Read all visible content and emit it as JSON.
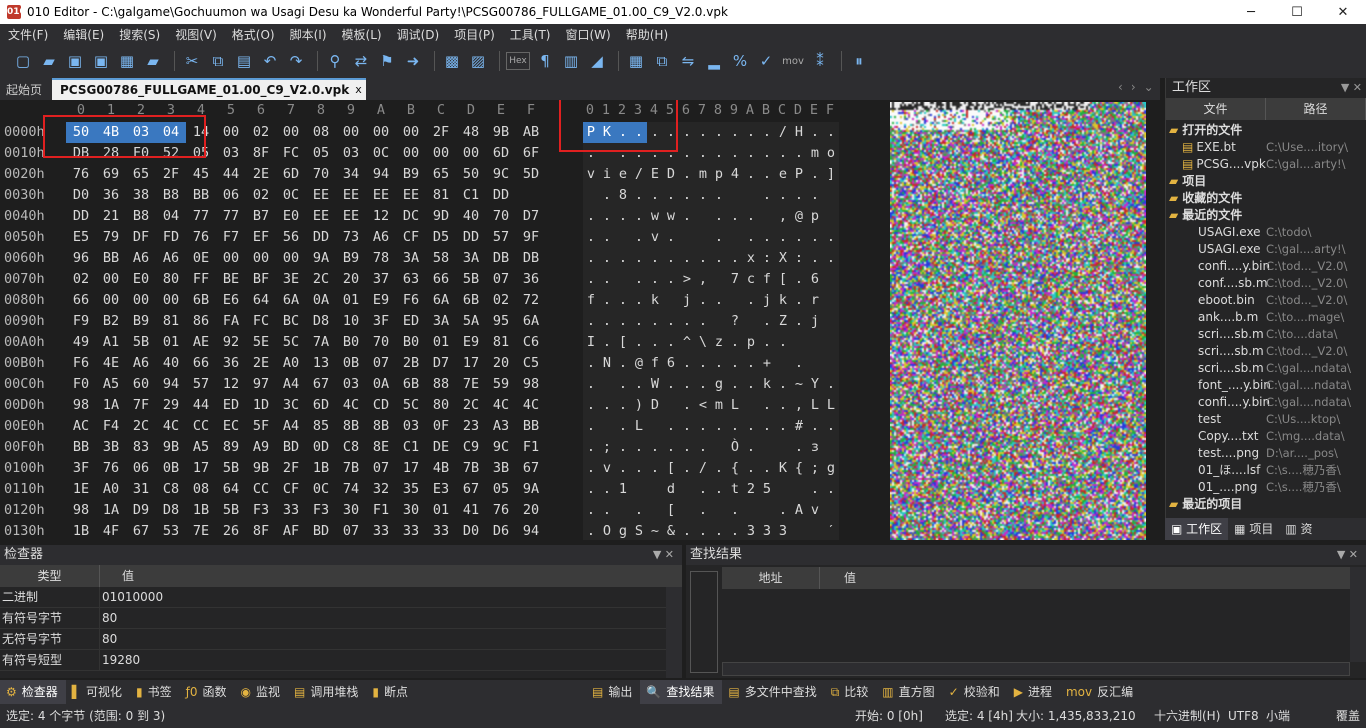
{
  "titlebar": {
    "app_glyph": "010",
    "title": "010 Editor - C:\\galgame\\Gochuumon wa Usagi Desu ka Wonderful Party!\\PCSG00786_FULLGAME_01.00_C9_V2.0.vpk",
    "minimize": "─",
    "maximize": "☐",
    "close": "✕"
  },
  "menu": [
    "文件(F)",
    "编辑(E)",
    "搜索(S)",
    "视图(V)",
    "格式(O)",
    "脚本(I)",
    "模板(L)",
    "调试(D)",
    "项目(P)",
    "工具(T)",
    "窗口(W)",
    "帮助(H)"
  ],
  "toolbar": {
    "hex_label": "Hex",
    "mov_label": "mov"
  },
  "tabs": {
    "start": "起始页",
    "file": "PCSG00786_FULLGAME_01.00_C9_V2.0.vpk",
    "close": "x",
    "nav_prev": "‹",
    "nav_next": "›",
    "nav_menu": "⌄"
  },
  "hex": {
    "ruler": [
      "0",
      "1",
      "2",
      "3",
      "4",
      "5",
      "6",
      "7",
      "8",
      "9",
      "A",
      "B",
      "C",
      "D",
      "E",
      "F"
    ],
    "ascii_ruler": [
      "0",
      "1",
      "2",
      "3",
      "4",
      "5",
      "6",
      "7",
      "8",
      "9",
      "A",
      "B",
      "C",
      "D",
      "E",
      "F"
    ],
    "rows": [
      {
        "addr": "0000h",
        "bytes": [
          "50",
          "4B",
          "03",
          "04",
          "14",
          "00",
          "02",
          "00",
          "08",
          "00",
          "00",
          "00",
          "2F",
          "48",
          "9B",
          "AB"
        ],
        "ascii": [
          "P",
          "K",
          ".",
          ".",
          ".",
          ".",
          ".",
          ".",
          ".",
          ".",
          ".",
          ".",
          "/",
          "H",
          ".",
          "."
        ]
      },
      {
        "addr": "0010h",
        "bytes": [
          "DB",
          "28",
          "F0",
          "52",
          "05",
          "03",
          "8F",
          "FC",
          "05",
          "03",
          "0C",
          "00",
          "00",
          "00",
          "6D",
          "6F"
        ],
        "ascii": [
          ".",
          "",
          ".",
          ".",
          ".",
          ".",
          ".",
          ".",
          ".",
          ".",
          ".",
          ".",
          ".",
          ".",
          "m",
          "o"
        ]
      },
      {
        "addr": "0020h",
        "bytes": [
          "76",
          "69",
          "65",
          "2F",
          "45",
          "44",
          "2E",
          "6D",
          "70",
          "34",
          "94",
          "B9",
          "65",
          "50",
          "9C",
          "5D"
        ],
        "ascii": [
          "v",
          "i",
          "e",
          "/",
          "E",
          "D",
          ".",
          "m",
          "p",
          "4",
          ".",
          ".",
          "e",
          "P",
          ".",
          "]"
        ]
      },
      {
        "addr": "0030h",
        "bytes": [
          "D0",
          "36",
          "38",
          "B8",
          "BB",
          "06",
          "02",
          "0C",
          "EE",
          "EE",
          "EE",
          "EE",
          "81",
          "C1",
          "DD",
          ""
        ],
        "ascii": [
          "",
          ".",
          "8",
          ".",
          ".",
          ".",
          ".",
          ".",
          ".",
          "",
          "",
          ".",
          ".",
          ".",
          ".",
          ""
        ]
      },
      {
        "addr": "0040h",
        "bytes": [
          "DD",
          "21",
          "B8",
          "04",
          "77",
          "77",
          "B7",
          "E0",
          "EE",
          "EE",
          "12",
          "DC",
          "9D",
          "40",
          "70",
          "D7"
        ],
        "ascii": [
          ".",
          ".",
          ".",
          ".",
          "w",
          "w",
          ".",
          "",
          ".",
          ".",
          ".",
          "",
          ",",
          "@",
          "p",
          ""
        ]
      },
      {
        "addr": "0050h",
        "bytes": [
          "E5",
          "79",
          "DF",
          "FD",
          "76",
          "F7",
          "EF",
          "56",
          "DD",
          "73",
          "A6",
          "CF",
          "D5",
          "DD",
          "57",
          "9F"
        ],
        "ascii": [
          ".",
          ".",
          "",
          ".",
          "v",
          ".",
          "",
          "",
          ".",
          "",
          ".",
          ".",
          ".",
          ".",
          ".",
          "."
        ]
      },
      {
        "addr": "0060h",
        "bytes": [
          "96",
          "BB",
          "A6",
          "A6",
          "0E",
          "00",
          "00",
          "00",
          "9A",
          "B9",
          "78",
          "3A",
          "58",
          "3A",
          "DB",
          "DB"
        ],
        "ascii": [
          ".",
          ".",
          ".",
          ".",
          ".",
          ".",
          ".",
          ".",
          ".",
          ".",
          "x",
          ":",
          "X",
          ":",
          ".",
          "."
        ]
      },
      {
        "addr": "0070h",
        "bytes": [
          "02",
          "00",
          "E0",
          "80",
          "FF",
          "BE",
          "BF",
          "3E",
          "2C",
          "20",
          "37",
          "63",
          "66",
          "5B",
          "07",
          "36"
        ],
        "ascii": [
          ".",
          ".",
          "",
          ".",
          ".",
          ".",
          ">",
          ",",
          "",
          "7",
          "c",
          "f",
          "[",
          ".",
          "6",
          ""
        ]
      },
      {
        "addr": "0080h",
        "bytes": [
          "66",
          "00",
          "00",
          "00",
          "6B",
          "E6",
          "64",
          "6A",
          "0A",
          "01",
          "E9",
          "F6",
          "6A",
          "6B",
          "02",
          "72"
        ],
        "ascii": [
          "f",
          ".",
          ".",
          ".",
          "k",
          "",
          "j",
          ".",
          ".",
          "",
          ".",
          "j",
          "k",
          ".",
          "r",
          ""
        ]
      },
      {
        "addr": "0090h",
        "bytes": [
          "F9",
          "B2",
          "B9",
          "81",
          "86",
          "FA",
          "FC",
          "BC",
          "D8",
          "10",
          "3F",
          "ED",
          "3A",
          "5A",
          "95",
          "6A"
        ],
        "ascii": [
          ".",
          ".",
          ".",
          ".",
          ".",
          ".",
          ".",
          ".",
          "",
          "?",
          "",
          ".",
          "Z",
          ".",
          "j",
          ""
        ]
      },
      {
        "addr": "00A0h",
        "bytes": [
          "49",
          "A1",
          "5B",
          "01",
          "AE",
          "92",
          "5E",
          "5C",
          "7A",
          "B0",
          "70",
          "B0",
          "01",
          "E9",
          "81",
          "C6"
        ],
        "ascii": [
          "I",
          ".",
          "[",
          ".",
          ".",
          ".",
          "^",
          "\\",
          "z",
          ".",
          "p",
          ".",
          ".",
          "",
          "",
          ""
        ]
      },
      {
        "addr": "00B0h",
        "bytes": [
          "F6",
          "4E",
          "A6",
          "40",
          "66",
          "36",
          "2E",
          "A0",
          "13",
          "0B",
          "07",
          "2B",
          "D7",
          "17",
          "20",
          "C5"
        ],
        "ascii": [
          ".",
          "N",
          ".",
          "@",
          "f",
          "6",
          ".",
          ".",
          ".",
          ".",
          ".",
          "+",
          "",
          ".",
          "",
          ""
        ]
      },
      {
        "addr": "00C0h",
        "bytes": [
          "F0",
          "A5",
          "60",
          "94",
          "57",
          "12",
          "97",
          "A4",
          "67",
          "03",
          "0A",
          "6B",
          "88",
          "7E",
          "59",
          "98"
        ],
        "ascii": [
          ".",
          "",
          ".",
          ".",
          "W",
          ".",
          ".",
          ".",
          "g",
          ".",
          ".",
          "k",
          ".",
          "~",
          "Y",
          "."
        ]
      },
      {
        "addr": "00D0h",
        "bytes": [
          "98",
          "1A",
          "7F",
          "29",
          "44",
          "ED",
          "1D",
          "3C",
          "6D",
          "4C",
          "CD",
          "5C",
          "80",
          "2C",
          "4C",
          "4C"
        ],
        "ascii": [
          ".",
          ".",
          ".",
          ")",
          "D",
          "",
          ".",
          "<",
          "m",
          "L",
          "",
          ".",
          ".",
          ",",
          "L",
          "L"
        ]
      },
      {
        "addr": "00E0h",
        "bytes": [
          "AC",
          "F4",
          "2C",
          "4C",
          "CC",
          "EC",
          "5F",
          "A4",
          "85",
          "8B",
          "8B",
          "03",
          "0F",
          "23",
          "A3",
          "BB"
        ],
        "ascii": [
          ".",
          "",
          ".",
          "L",
          "",
          ".",
          ".",
          ".",
          ".",
          ".",
          ".",
          ".",
          ".",
          "#",
          ".",
          "."
        ]
      },
      {
        "addr": "00F0h",
        "bytes": [
          "BB",
          "3B",
          "83",
          "9B",
          "A5",
          "89",
          "A9",
          "BD",
          "0D",
          "C8",
          "8E",
          "C1",
          "DE",
          "C9",
          "9C",
          "F1"
        ],
        "ascii": [
          ".",
          ";",
          ".",
          ".",
          ".",
          ".",
          ".",
          ".",
          "",
          "Ò",
          ".",
          "",
          "",
          ".",
          "з",
          ""
        ]
      },
      {
        "addr": "0100h",
        "bytes": [
          "3F",
          "76",
          "06",
          "0B",
          "17",
          "5B",
          "9B",
          "2F",
          "1B",
          "7B",
          "07",
          "17",
          "4B",
          "7B",
          "3B",
          "67"
        ],
        "ascii": [
          ".",
          "v",
          ".",
          ".",
          ".",
          "[",
          ".",
          "/",
          ".",
          "{",
          ".",
          ".",
          "K",
          "{",
          ";",
          "g"
        ]
      },
      {
        "addr": "0110h",
        "bytes": [
          "1E",
          "A0",
          "31",
          "C8",
          "08",
          "64",
          "CC",
          "CF",
          "0C",
          "74",
          "32",
          "35",
          "E3",
          "67",
          "05",
          "9A"
        ],
        "ascii": [
          ".",
          ".",
          "1",
          "",
          "",
          "d",
          "",
          ".",
          ".",
          "t",
          "2",
          "5",
          "",
          "",
          ".",
          "."
        ]
      },
      {
        "addr": "0120h",
        "bytes": [
          "98",
          "1A",
          "D9",
          "D8",
          "1B",
          "5B",
          "F3",
          "33",
          "F3",
          "30",
          "F1",
          "30",
          "01",
          "41",
          "76",
          "20"
        ],
        "ascii": [
          ".",
          ".",
          "",
          ".",
          "",
          "[",
          "",
          ".",
          "",
          ".",
          "",
          "",
          ".",
          "A",
          "v",
          ""
        ]
      },
      {
        "addr": "0130h",
        "bytes": [
          "1B",
          "4F",
          "67",
          "53",
          "7E",
          "26",
          "8F",
          "AF",
          "BD",
          "07",
          "33",
          "33",
          "33",
          "D0",
          "D6",
          "94"
        ],
        "ascii": [
          ".",
          "O",
          "g",
          "S",
          "~",
          "&",
          ".",
          ".",
          ".",
          ".",
          "3",
          "3",
          "3",
          "",
          "",
          "ˊ"
        ]
      }
    ]
  },
  "workspace": {
    "title": "工作区",
    "pin": "▼ ✕",
    "col_file": "文件",
    "col_path": "路径",
    "groups": [
      {
        "label": "打开的文件",
        "items": [
          {
            "name": "EXE.bt",
            "path": "C:\\Use....itory\\"
          },
          {
            "name": "PCSG....vpk",
            "path": "C:\\gal....arty!\\"
          }
        ]
      },
      {
        "label": "项目",
        "items": []
      },
      {
        "label": "收藏的文件",
        "items": []
      },
      {
        "label": "最近的文件",
        "items": [
          {
            "name": "USAGI.exe",
            "path": "C:\\todo\\"
          },
          {
            "name": "USAGI.exe",
            "path": "C:\\gal....arty!\\"
          },
          {
            "name": "confi....y.bin",
            "path": "C:\\tod..._V2.0\\"
          },
          {
            "name": "conf....sb.m",
            "path": "C:\\tod..._V2.0\\"
          },
          {
            "name": "eboot.bin",
            "path": "C:\\tod..._V2.0\\"
          },
          {
            "name": "ank....b.m",
            "path": "C:\\to....mage\\"
          },
          {
            "name": "scri....sb.m",
            "path": "C:\\to....data\\"
          },
          {
            "name": "scri....sb.m",
            "path": "C:\\tod..._V2.0\\"
          },
          {
            "name": "scri....sb.m",
            "path": "C:\\gal....ndata\\"
          },
          {
            "name": "font_....y.bin",
            "path": "C:\\gal....ndata\\"
          },
          {
            "name": "confi....y.bin",
            "path": "C:\\gal....ndata\\"
          },
          {
            "name": "test",
            "path": "C:\\Us....ktop\\"
          },
          {
            "name": "Copy....txt",
            "path": "C:\\mg....data\\"
          },
          {
            "name": "test....png",
            "path": "D:\\ar...._pos\\"
          },
          {
            "name": "01_ほ....lsf",
            "path": "C:\\s....穂乃香\\"
          },
          {
            "name": "01_....png",
            "path": "C:\\s....穂乃香\\"
          }
        ]
      },
      {
        "label": "最近的项目",
        "items": []
      }
    ],
    "tabs": [
      "工作区",
      "项目",
      "资"
    ]
  },
  "inspector": {
    "title": "检查器",
    "ctl": "▼ ✕",
    "col_type": "类型",
    "col_value": "值",
    "rows": [
      {
        "k": "二进制",
        "v": "01010000"
      },
      {
        "k": "有符号字节",
        "v": "80"
      },
      {
        "k": "无符号字节",
        "v": "80"
      },
      {
        "k": "有符号短型",
        "v": "19280"
      }
    ]
  },
  "findresults": {
    "title": "查找结果",
    "ctl": "▼ ✕",
    "col_addr": "地址",
    "col_value": "值"
  },
  "bottomtabs_left": [
    {
      "icon": "⚙",
      "label": "检查器",
      "active": true
    },
    {
      "icon": "▌",
      "label": "可视化"
    },
    {
      "icon": "▮",
      "label": "书签"
    },
    {
      "icon": "ƒ0",
      "label": "函数"
    },
    {
      "icon": "◉",
      "label": "监视"
    },
    {
      "icon": "▤",
      "label": "调用堆栈"
    },
    {
      "icon": "▮",
      "label": "断点"
    }
  ],
  "bottomtabs_right": [
    {
      "icon": "▤",
      "label": "输出"
    },
    {
      "icon": "🔍",
      "label": "查找结果",
      "active": true
    },
    {
      "icon": "▤",
      "label": "多文件中查找"
    },
    {
      "icon": "⧉",
      "label": "比较"
    },
    {
      "icon": "▥",
      "label": "直方图"
    },
    {
      "icon": "✓",
      "label": "校验和"
    },
    {
      "icon": "▶",
      "label": "进程"
    },
    {
      "icon": "mov",
      "label": "反汇编"
    }
  ],
  "status": {
    "selection": "选定: 4 个字节 (范围: 0 到 3)",
    "start": "开始: 0 [0h]",
    "sel": "选定: 4 [4h]",
    "size": "大小: 1,435,833,210",
    "mode": "十六进制(H)",
    "enc": "UTF8",
    "endian": "小端",
    "ovr": "覆盖"
  },
  "colors": {
    "selection": "#3a78c0",
    "annotation": "#e02020",
    "background": "#1e1e1e",
    "panel": "#2d2d30"
  }
}
